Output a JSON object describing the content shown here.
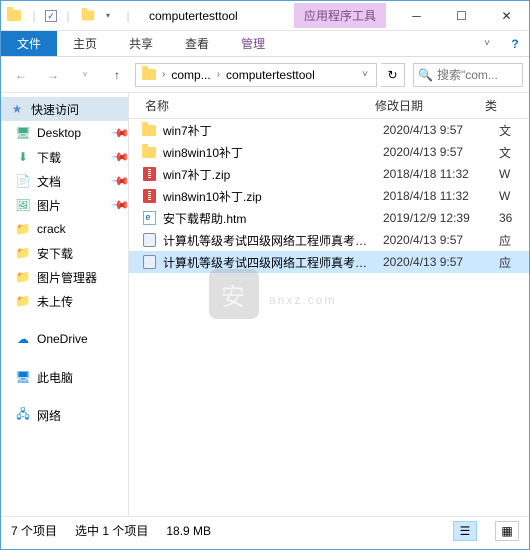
{
  "title": "computertesttool",
  "context_tab": "应用程序工具",
  "ribbon": {
    "file": "文件",
    "home": "主页",
    "share": "共享",
    "view": "查看",
    "manage": "管理"
  },
  "breadcrumb": {
    "part1": "comp...",
    "part2": "computertesttool"
  },
  "search": {
    "placeholder": "搜索\"com..."
  },
  "nav": {
    "quick_access": "快速访问",
    "items": [
      {
        "label": "Desktop",
        "pinned": true
      },
      {
        "label": "下载",
        "pinned": true
      },
      {
        "label": "文档",
        "pinned": true
      },
      {
        "label": "图片",
        "pinned": true
      },
      {
        "label": "crack",
        "pinned": false
      },
      {
        "label": "安下载",
        "pinned": false
      },
      {
        "label": "图片管理器",
        "pinned": false
      },
      {
        "label": "未上传",
        "pinned": false
      }
    ],
    "onedrive": "OneDrive",
    "this_pc": "此电脑",
    "network": "网络"
  },
  "columns": {
    "name": "名称",
    "modified": "修改日期",
    "type": "类"
  },
  "files": [
    {
      "icon": "folder",
      "name": "win7补丁",
      "date": "2020/4/13 9:57",
      "type": "文",
      "selected": false
    },
    {
      "icon": "folder",
      "name": "win8win10补丁",
      "date": "2020/4/13 9:57",
      "type": "文",
      "selected": false
    },
    {
      "icon": "zip",
      "name": "win7补丁.zip",
      "date": "2018/4/18 11:32",
      "type": "W",
      "selected": false
    },
    {
      "icon": "zip",
      "name": "win8win10补丁.zip",
      "date": "2018/4/18 11:32",
      "type": "W",
      "selected": false
    },
    {
      "icon": "htm",
      "name": "安下载帮助.htm",
      "date": "2019/12/9 12:39",
      "type": "36",
      "selected": false
    },
    {
      "icon": "exe",
      "name": "计算机等级考试四级网络工程师真考题库...",
      "date": "2020/4/13 9:57",
      "type": "应",
      "selected": false
    },
    {
      "icon": "exe",
      "name": "计算机等级考试四级网络工程师真考题库...",
      "date": "2020/4/13 9:57",
      "type": "应",
      "selected": true
    }
  ],
  "status": {
    "count": "7 个项目",
    "selection": "选中 1 个项目",
    "size": "18.9 MB"
  },
  "watermark": "anxz.com"
}
